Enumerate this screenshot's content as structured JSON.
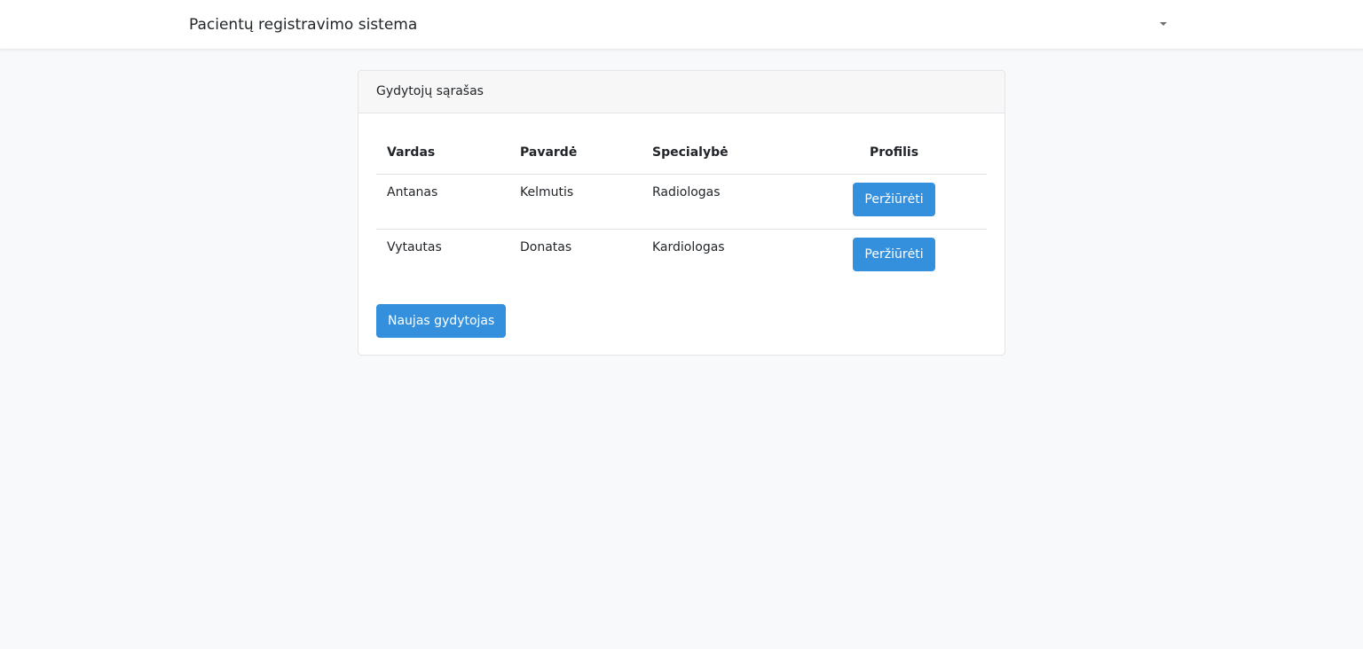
{
  "navbar": {
    "brand": "Pacientų registravimo sistema",
    "dropdown_icon": "caret-down-icon"
  },
  "card": {
    "title": "Gydytojų sąrašas",
    "table": {
      "headers": [
        "Vardas",
        "Pavardė",
        "Specialybė",
        "Profilis"
      ],
      "rows": [
        {
          "vardas": "Antanas",
          "pavarde": "Kelmutis",
          "specialybe": "Radiologas",
          "action": "Peržiūrėti"
        },
        {
          "vardas": "Vytautas",
          "pavarde": "Donatas",
          "specialybe": "Kardiologas",
          "action": "Peržiūrėti"
        }
      ]
    },
    "new_button": "Naujas gydytojas"
  },
  "colors": {
    "primary": "#3490dc",
    "background": "#f8f9fb",
    "card_header": "#f7f7f7"
  }
}
